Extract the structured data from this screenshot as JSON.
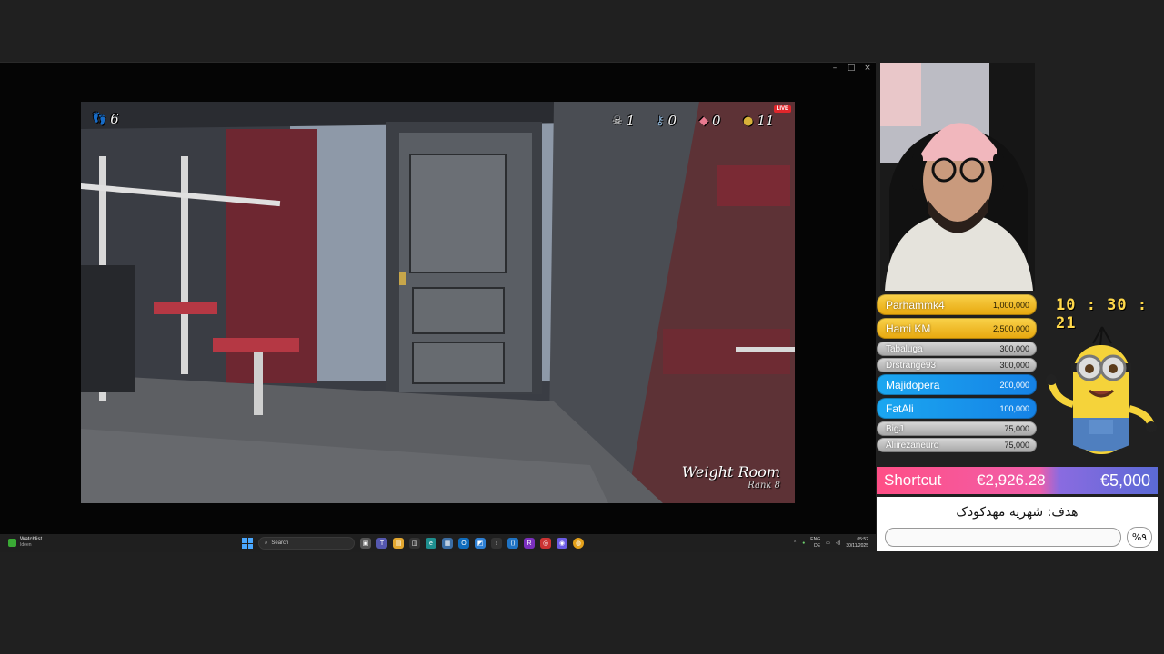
{
  "window": {
    "controls": [
      "–",
      "□",
      "×"
    ]
  },
  "game": {
    "hud": {
      "footsteps": "6",
      "skulls": "1",
      "keys": "0",
      "gems": "0",
      "coins": "11",
      "live_badge": "LIVE"
    },
    "room_name": "Weight Room",
    "room_rank": "Rank 8"
  },
  "taskbar": {
    "widget_title": "Watchlist",
    "widget_subtitle": "Ideen",
    "search_placeholder": "Search",
    "lang_top": "ENG",
    "lang_bottom": "DE",
    "time": "05:52",
    "date": "30/11/2025"
  },
  "overlay": {
    "clock": "10 : 30 : 21",
    "leaderboard": [
      {
        "name": "Parhammk4",
        "amount": "1,000,000",
        "tier": "gold"
      },
      {
        "name": "Hami KM",
        "amount": "2,500,000",
        "tier": "gold"
      },
      {
        "name": "Tabaluga",
        "amount": "300,000",
        "tier": "silver"
      },
      {
        "name": "Drstrange93",
        "amount": "300,000",
        "tier": "silver"
      },
      {
        "name": "Majidopera",
        "amount": "200,000",
        "tier": "blue"
      },
      {
        "name": "FatAli",
        "amount": "100,000",
        "tier": "blue"
      },
      {
        "name": "BigJ",
        "amount": "75,000",
        "tier": "silver"
      },
      {
        "name": "Aliirezaneuro",
        "amount": "75,000",
        "tier": "silver"
      }
    ],
    "donation": {
      "label": "Shortcut",
      "current": "€2,926.28",
      "goal": "€5,000"
    },
    "goal_text": "هدف: شهریه مهدکودک",
    "goal_percent": "%۹"
  },
  "colors": {
    "clock": "#ffd84a",
    "donation_pink": "#ff4f86",
    "donation_blue": "#5b6ad6"
  }
}
